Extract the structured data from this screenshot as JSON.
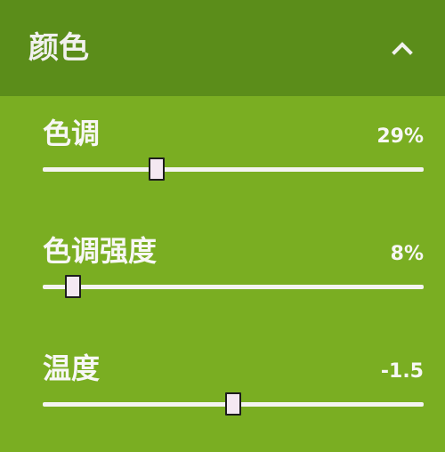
{
  "panel": {
    "title": "颜色",
    "collapse_icon": "chevron-up-icon",
    "colors": {
      "header_bg": "#5b8d1a",
      "body_bg": "#7aae22",
      "text": "#f7f7f4",
      "thumb": "#f4e8f2"
    }
  },
  "sliders": [
    {
      "label": "色调",
      "value_text": "29%",
      "level": 0.3
    },
    {
      "label": "色调强度",
      "value_text": "8%",
      "level": 0.08
    },
    {
      "label": "温度",
      "value_text": "-1.5",
      "level": 0.5
    }
  ]
}
